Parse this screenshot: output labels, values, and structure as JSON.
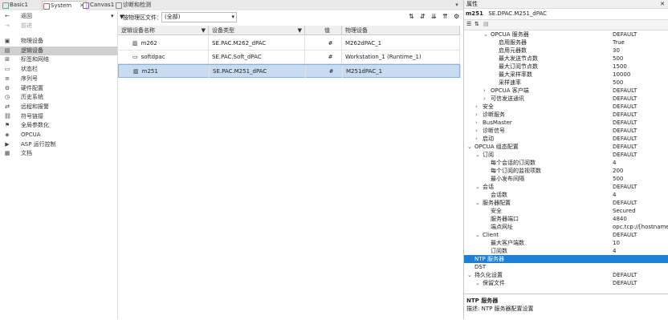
{
  "tabs": [
    {
      "label": "Basic1"
    },
    {
      "label": "System"
    },
    {
      "label": "Canvas1"
    },
    {
      "label": "诊断和检测"
    }
  ],
  "nav": {
    "back": "返回",
    "forward": "前进",
    "items": [
      {
        "label": "物理设备",
        "icon": "device-icon"
      },
      {
        "label": "逻辑设备",
        "icon": "logic-device-icon"
      },
      {
        "label": "标签和网络",
        "icon": "network-icon"
      },
      {
        "label": "状态栏",
        "icon": "status-icon"
      },
      {
        "label": "序列号",
        "icon": "serial-icon"
      },
      {
        "label": "硬件配置",
        "icon": "hardware-icon"
      },
      {
        "label": "历史系统",
        "icon": "history-icon"
      },
      {
        "label": "远程和报警",
        "icon": "remote-icon"
      },
      {
        "label": "符号链接",
        "icon": "link-icon"
      },
      {
        "label": "全局参数化",
        "icon": "param-icon"
      },
      {
        "label": "OPCUA",
        "icon": "opcua-icon"
      },
      {
        "label": "ASP 运行控制",
        "icon": "asp-icon"
      },
      {
        "label": "文档",
        "icon": "doc-icon"
      }
    ]
  },
  "toolbar": {
    "filter_label": "按物理区文件：",
    "filter_value": "(全部)"
  },
  "grid": {
    "headers": [
      "逻辑设备名称",
      "设备类型",
      "值",
      "物理设备"
    ],
    "rows": [
      {
        "name": "m262",
        "type": "SE.PAC.M262_dPAC",
        "mark": "#",
        "physical": "M262dPAC_1"
      },
      {
        "name": "softdpac",
        "type": "SE.PAC.Soft_dPAC",
        "mark": "#",
        "physical": "Workstation_1 (Runtime_1)"
      },
      {
        "name": "m251",
        "type": "SE.PAC.M251_dPAC",
        "mark": "#",
        "physical": "M251dPAC_1"
      }
    ]
  },
  "panel": {
    "title": "属性",
    "device_name": "m251",
    "device_type": "SE.DPAC.M251_dPAC",
    "rows": [
      {
        "name": "OPCUA 服务器",
        "value": "DEFAULT",
        "level": 2,
        "expander": "v"
      },
      {
        "name": "启用服务器",
        "value": "True",
        "level": 3,
        "expander": ""
      },
      {
        "name": "启用元器数",
        "value": "30",
        "level": 3,
        "expander": ""
      },
      {
        "name": "最大发送节点数",
        "value": "500",
        "level": 3,
        "expander": ""
      },
      {
        "name": "最大订阅节点数",
        "value": "1500",
        "level": 3,
        "expander": ""
      },
      {
        "name": "最大采样率数",
        "value": "10000",
        "level": 3,
        "expander": ""
      },
      {
        "name": "采样速率",
        "value": "500",
        "level": 3,
        "expander": ""
      },
      {
        "name": "OPCUA 客户端",
        "value": "DEFAULT",
        "level": 2,
        "expander": ">"
      },
      {
        "name": "可信发送通讯",
        "value": "DEFAULT",
        "level": 2,
        "expander": ">"
      },
      {
        "name": "安全",
        "value": "DEFAULT",
        "level": 1,
        "expander": ">"
      },
      {
        "name": "诊断服务",
        "value": "DEFAULT",
        "level": 1,
        "expander": ">"
      },
      {
        "name": "BusMaster",
        "value": "DEFAULT",
        "level": 1,
        "expander": ">"
      },
      {
        "name": "诊断信号",
        "value": "DEFAULT",
        "level": 1,
        "expander": ">"
      },
      {
        "name": "启动",
        "value": "DEFAULT",
        "level": 1,
        "expander": ">"
      },
      {
        "name": "OPCUA 组态配置",
        "value": "DEFAULT",
        "level": 0,
        "expander": "v"
      },
      {
        "name": "订阅",
        "value": "DEFAULT",
        "level": 1,
        "expander": "v"
      },
      {
        "name": "每个会话的订阅数",
        "value": "4",
        "level": 2,
        "expander": ""
      },
      {
        "name": "每个订阅的监视项数",
        "value": "200",
        "level": 2,
        "expander": ""
      },
      {
        "name": "最小发布间隔",
        "value": "500",
        "level": 2,
        "expander": ""
      },
      {
        "name": "会话",
        "value": "DEFAULT",
        "level": 1,
        "expander": "v"
      },
      {
        "name": "会话数",
        "value": "4",
        "level": 2,
        "expander": ""
      },
      {
        "name": "服务器配置",
        "value": "DEFAULT",
        "level": 1,
        "expander": "v"
      },
      {
        "name": "安全",
        "value": "Secured",
        "level": 2,
        "expander": ""
      },
      {
        "name": "服务器端口",
        "value": "4840",
        "level": 2,
        "expander": ""
      },
      {
        "name": "端点网址",
        "value": "opc.tcp://[hostname]",
        "level": 2,
        "expander": ""
      },
      {
        "name": "Client",
        "value": "DEFAULT",
        "level": 1,
        "expander": "v"
      },
      {
        "name": "最大客户端数",
        "value": "10",
        "level": 2,
        "expander": ""
      },
      {
        "name": "订阅数",
        "value": "4",
        "level": 2,
        "expander": ""
      },
      {
        "name": "NTP 服务器",
        "value": "",
        "level": 0,
        "expander": ">"
      },
      {
        "name": "DST",
        "value": "",
        "level": 0,
        "expander": ""
      },
      {
        "name": "持久化设置",
        "value": "DEFAULT",
        "level": 0,
        "expander": "v"
      },
      {
        "name": "保留文件",
        "value": "DEFAULT",
        "level": 1,
        "expander": "v"
      }
    ],
    "footer_title": "NTP 服务器",
    "footer_desc": "描述: NTP 服务器配置设置"
  }
}
